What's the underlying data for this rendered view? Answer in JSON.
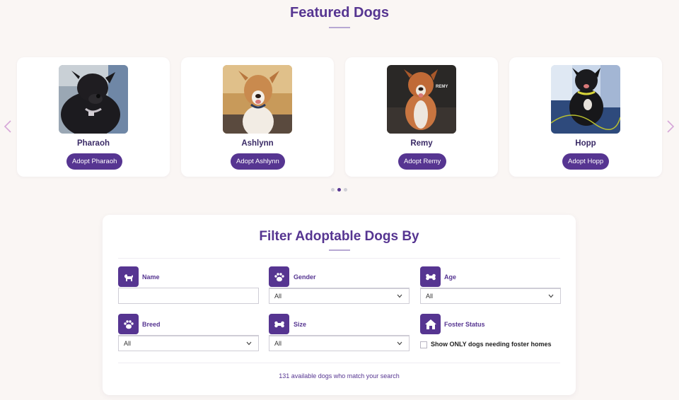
{
  "featured": {
    "title": "Featured Dogs",
    "dogs": [
      {
        "name": "Pharaoh",
        "button": "Adopt Pharaoh"
      },
      {
        "name": "Ashlynn",
        "button": "Adopt Ashlynn"
      },
      {
        "name": "Remy",
        "button": "Adopt Remy",
        "photo_text": "REMY"
      },
      {
        "name": "Hopp",
        "button": "Adopt Hopp"
      }
    ],
    "active_dot": 1
  },
  "filter": {
    "title": "Filter Adoptable Dogs By",
    "name": {
      "label": "Name",
      "value": "",
      "icon": "dog-icon"
    },
    "gender": {
      "label": "Gender",
      "value": "All",
      "icon": "paw-icon"
    },
    "age": {
      "label": "Age",
      "value": "All",
      "icon": "bone-icon"
    },
    "breed": {
      "label": "Breed",
      "value": "All",
      "icon": "paw-icon"
    },
    "size": {
      "label": "Size",
      "value": "All",
      "icon": "bone-icon"
    },
    "foster": {
      "label": "Foster Status",
      "checkbox_label": "Show ONLY dogs needing foster homes",
      "checked": false,
      "icon": "house-icon"
    },
    "result": "131 available dogs who match your search"
  },
  "colors": {
    "brand": "#563591",
    "background": "#faf6f4",
    "arrow": "#d6a6d8"
  }
}
